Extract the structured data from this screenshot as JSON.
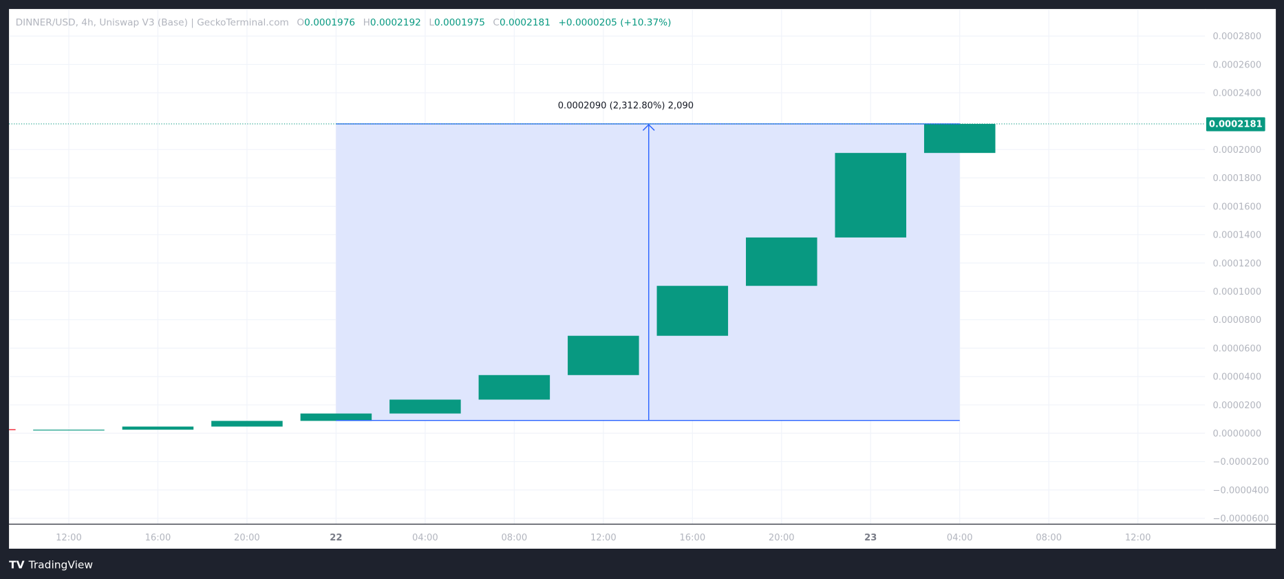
{
  "legend": {
    "symbol": "DINNER/USD, 4h, Uniswap V3 (Base) | GeckoTerminal.com",
    "o_label": "O",
    "o": "0.0001976",
    "h_label": "H",
    "h": "0.0002192",
    "l_label": "L",
    "l": "0.0001975",
    "c_label": "C",
    "c": "0.0002181",
    "change": "+0.0000205 (+10.37%)"
  },
  "price_axis": {
    "ticks": [
      "0.0002800",
      "0.0002600",
      "0.0002400",
      "0.0002000",
      "0.0001800",
      "0.0001600",
      "0.0001400",
      "0.0001200",
      "0.0001000",
      "0.0000800",
      "0.0000600",
      "0.0000400",
      "0.0000200",
      "0.0000000",
      "−0.0000200",
      "−0.0000400",
      "−0.0000600"
    ],
    "tick_values": [
      0.00028,
      0.00026,
      0.00024,
      0.0002,
      0.00018,
      0.00016,
      0.00014,
      0.00012,
      0.0001,
      8e-05,
      6e-05,
      4e-05,
      2e-05,
      0,
      -2e-05,
      -4e-05,
      -6e-05
    ],
    "last_price_label": "0.0002181",
    "last_price": 0.0002181
  },
  "time_axis": {
    "ticks": [
      "12:00",
      "16:00",
      "20:00",
      "22",
      "04:00",
      "08:00",
      "12:00",
      "16:00",
      "20:00",
      "23",
      "04:00",
      "08:00",
      "12:00"
    ],
    "bold": [
      "22",
      "23"
    ]
  },
  "candles": [
    {
      "open": 2e-06,
      "close": 2.5e-06
    },
    {
      "open": 2.5e-06,
      "close": 4.7e-06
    },
    {
      "open": 4.7e-06,
      "close": 8.7e-06
    },
    {
      "open": 8.7e-06,
      "close": 1.39e-05
    },
    {
      "open": 1.39e-05,
      "close": 2.37e-05
    },
    {
      "open": 2.37e-05,
      "close": 4.1e-05
    },
    {
      "open": 4.1e-05,
      "close": 6.87e-05
    },
    {
      "open": 6.87e-05,
      "close": 0.0001039
    },
    {
      "open": 0.0001039,
      "close": 0.000138
    },
    {
      "open": 0.000138,
      "close": 0.0001976
    },
    {
      "open": 0.0001976,
      "close": 0.0002181
    }
  ],
  "measure": {
    "label": "0.0002090 (2,312.80%) 2,090",
    "from": 9e-06,
    "to": 0.0002181
  },
  "footer": {
    "brand": "TradingView"
  },
  "colors": {
    "up": "#089981",
    "measure": "#2962ff",
    "measure_fill": "#dde5fd",
    "background": "#1e222d"
  }
}
